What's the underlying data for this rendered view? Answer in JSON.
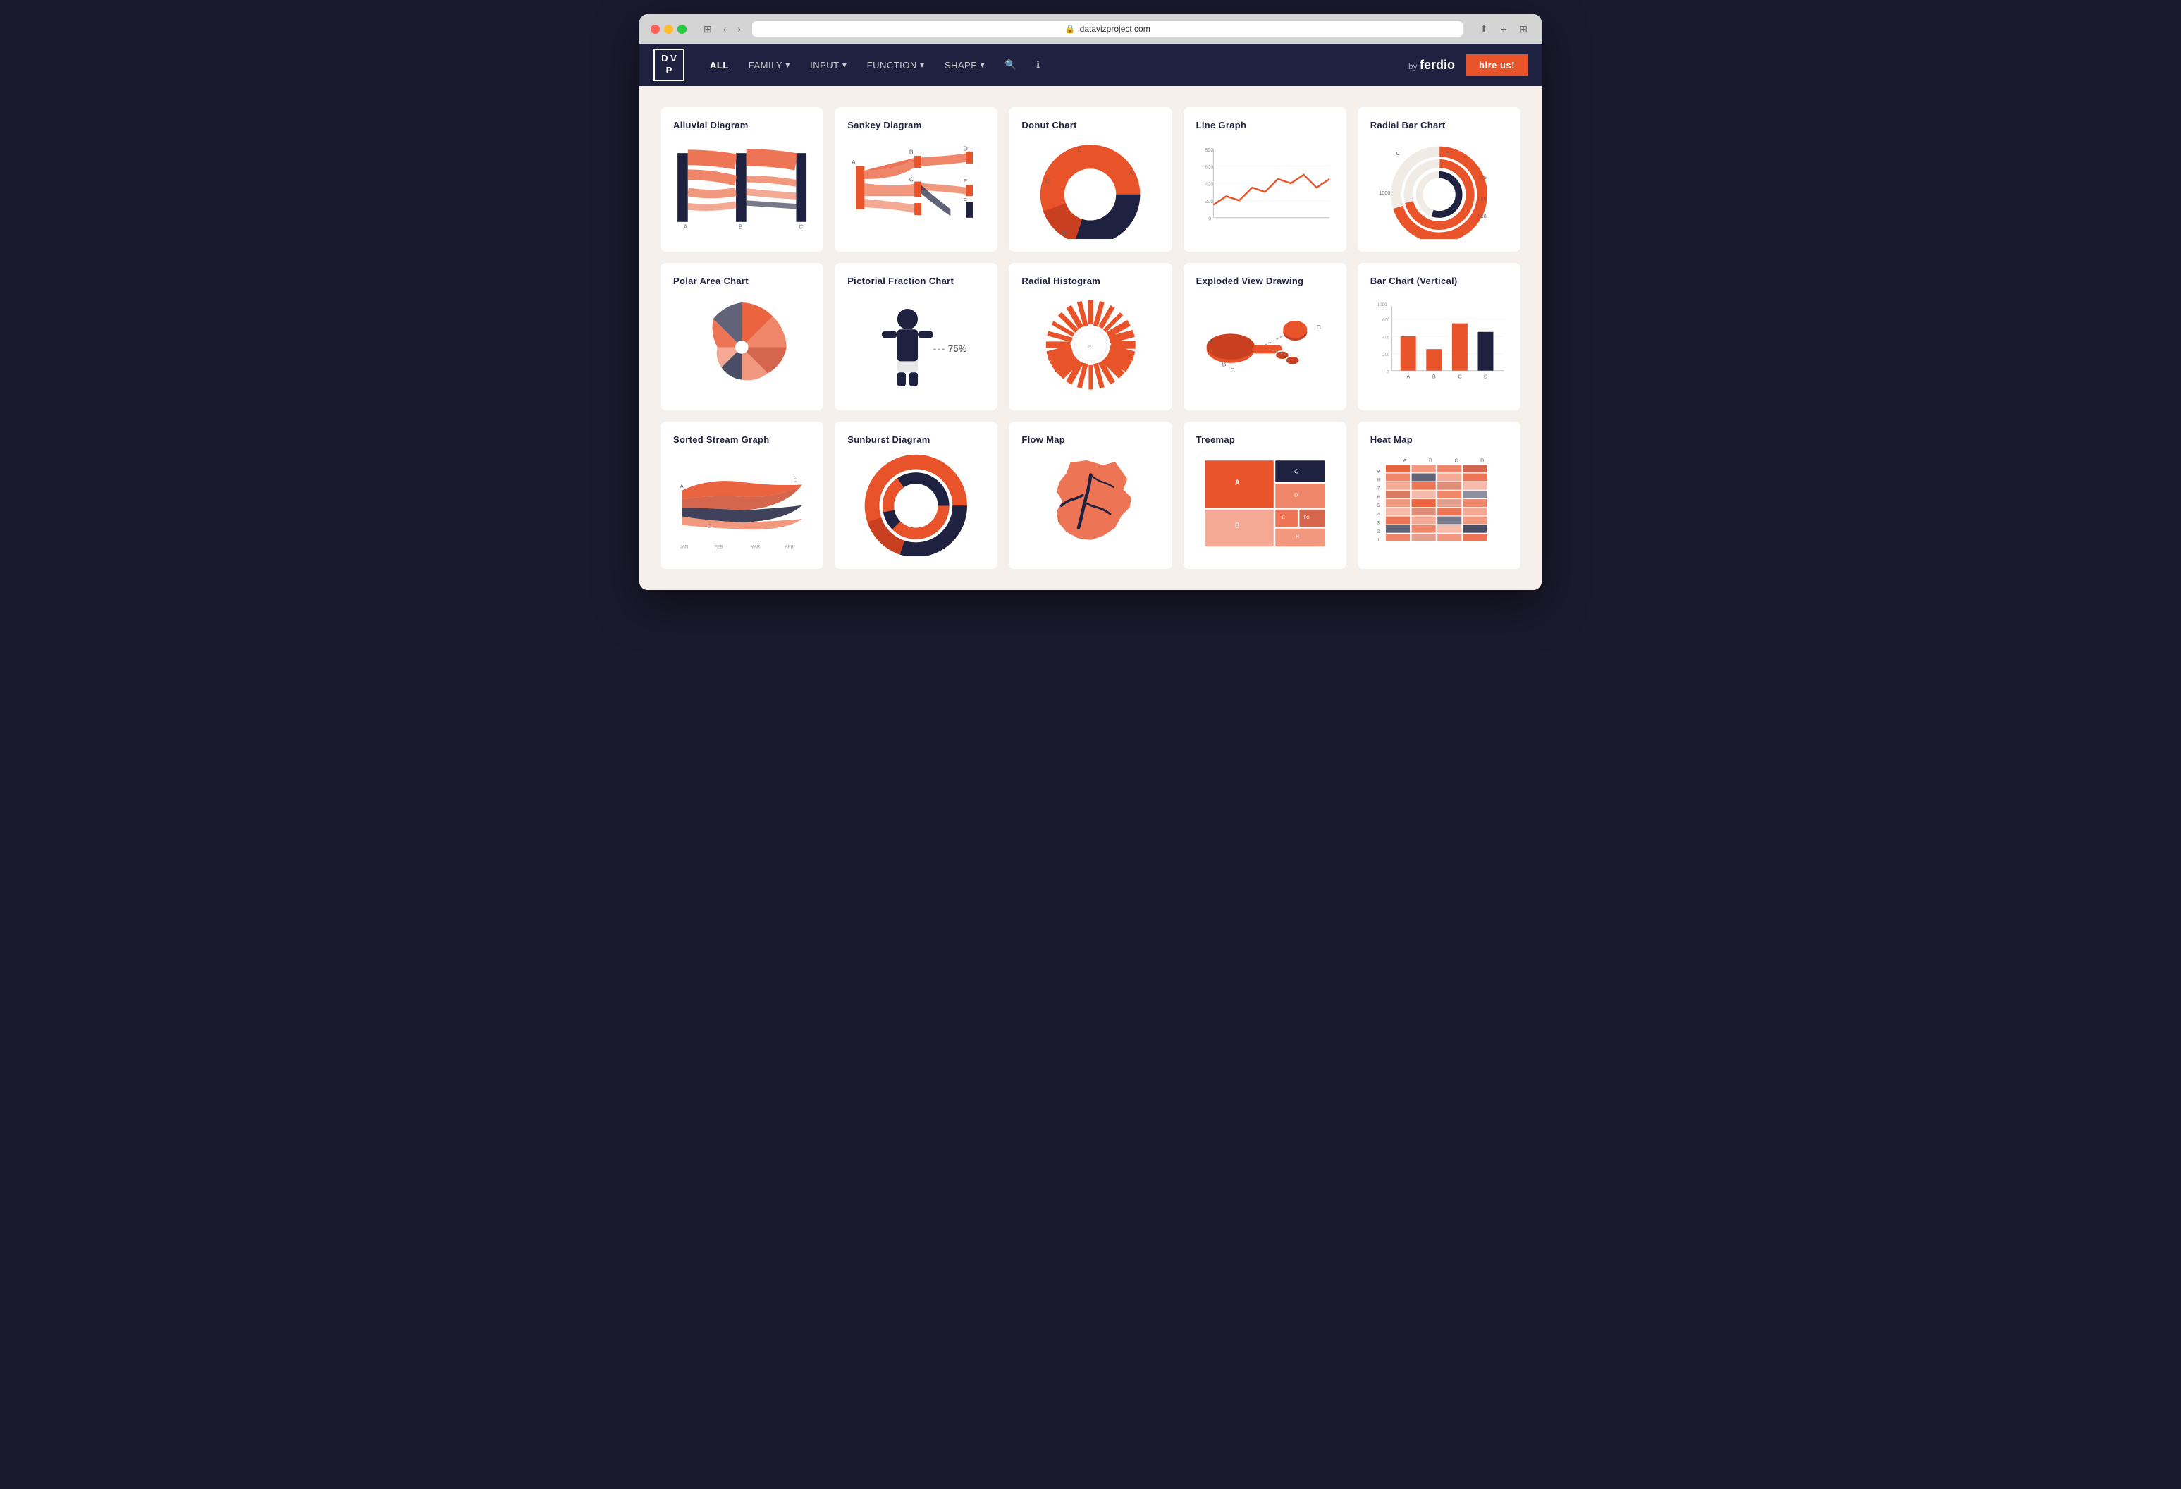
{
  "browser": {
    "url": "datavizproject.com"
  },
  "nav": {
    "logo": "D V\nP",
    "links": [
      {
        "label": "ALL",
        "active": true
      },
      {
        "label": "FAMILY",
        "dropdown": true
      },
      {
        "label": "INPUT",
        "dropdown": true
      },
      {
        "label": "FUNCTION",
        "dropdown": true
      },
      {
        "label": "SHAPE",
        "dropdown": true
      }
    ],
    "hire_label": "hire us!"
  },
  "cards": [
    {
      "id": "alluvial-diagram",
      "title": "Alluvial Diagram"
    },
    {
      "id": "sankey-diagram",
      "title": "Sankey Diagram"
    },
    {
      "id": "donut-chart",
      "title": "Donut Chart"
    },
    {
      "id": "line-graph",
      "title": "Line Graph"
    },
    {
      "id": "radial-bar-chart",
      "title": "Radial Bar Chart"
    },
    {
      "id": "polar-area-chart",
      "title": "Polar Area Chart"
    },
    {
      "id": "pictorial-fraction-chart",
      "title": "Pictorial Fraction Chart"
    },
    {
      "id": "radial-histogram",
      "title": "Radial Histogram"
    },
    {
      "id": "exploded-view-drawing",
      "title": "Exploded View Drawing"
    },
    {
      "id": "bar-chart-vertical",
      "title": "Bar Chart (Vertical)"
    },
    {
      "id": "sorted-stream-graph",
      "title": "Sorted Stream Graph"
    },
    {
      "id": "sunburst-diagram",
      "title": "Sunburst Diagram"
    },
    {
      "id": "flow-map",
      "title": "Flow Map"
    },
    {
      "id": "treemap",
      "title": "Treemap"
    },
    {
      "id": "heat-map",
      "title": "Heat Map"
    }
  ]
}
